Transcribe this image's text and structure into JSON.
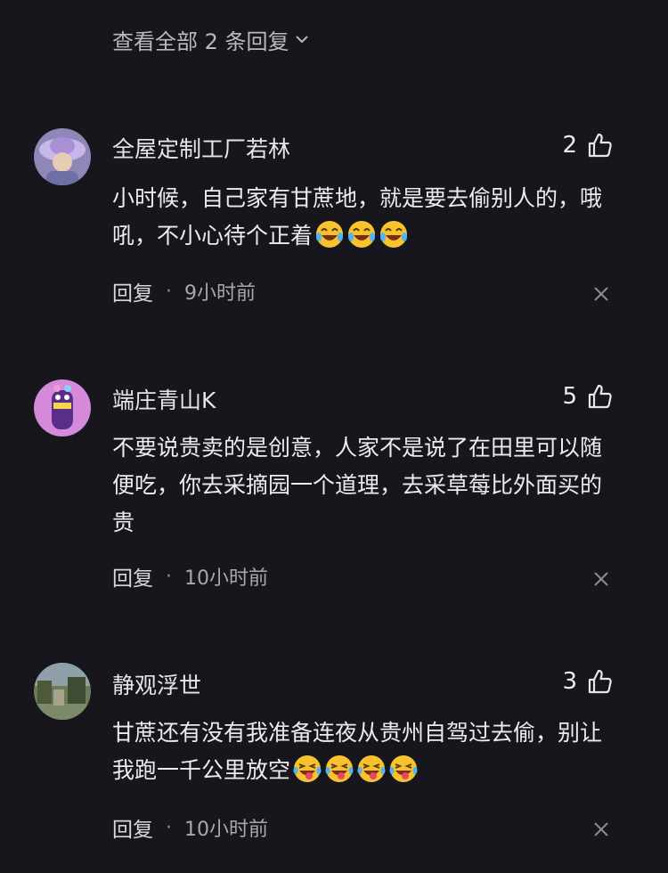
{
  "view_all": {
    "label": "查看全部 2 条回复"
  },
  "comments": [
    {
      "username": "全屋定制工厂若林",
      "likes": "2",
      "text": "小时候，自己家有甘蔗地，就是要去偷别人的，哦吼，不小心待个正着",
      "emojis": [
        "laugh-cry-icon",
        "laugh-cry-icon",
        "laugh-cry-icon"
      ],
      "reply_label": "回复",
      "separator": "·",
      "time": "9小时前"
    },
    {
      "username": "端庄青山K",
      "likes": "5",
      "text": "不要说贵卖的是创意，人家不是说了在田里可以随便吃，你去采摘园一个道理，去采草莓比外面买的贵",
      "emojis": [],
      "reply_label": "回复",
      "separator": "·",
      "time": "10小时前"
    },
    {
      "username": "静观浮世",
      "likes": "3",
      "text": "甘蔗还有没有我准备连夜从贵州自驾过去偷，别让我跑一千公里放空",
      "emojis": [
        "tongue-laugh-icon",
        "tongue-laugh-icon",
        "tongue-laugh-icon",
        "tongue-laugh-icon"
      ],
      "reply_label": "回复",
      "separator": "·",
      "time": "10小时前"
    }
  ]
}
